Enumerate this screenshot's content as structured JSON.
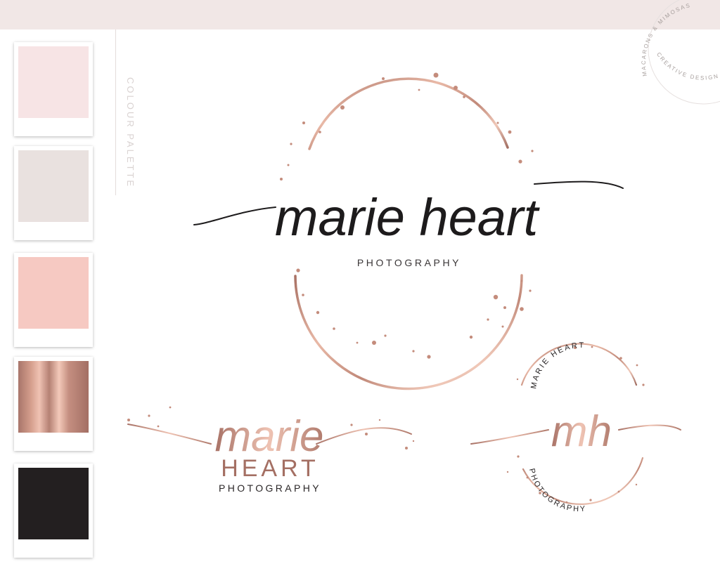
{
  "studio_badge": {
    "upper_text": "MACARONS & MIMOSAS",
    "lower_text": "CREATIVE DESIGN"
  },
  "palette": {
    "label": "COLOUR PALETTE",
    "swatches": [
      {
        "name": "blush",
        "color": "#f7e4e5"
      },
      {
        "name": "greige",
        "color": "#e9e1df"
      },
      {
        "name": "peach",
        "color": "#f6c9c2"
      },
      {
        "name": "rose-gold",
        "color": "#b98576"
      },
      {
        "name": "black",
        "color": "#231f20"
      }
    ]
  },
  "main_logo": {
    "script": "marie heart",
    "tagline": "PHOTOGRAPHY"
  },
  "secondary_logo": {
    "script": "marie",
    "name": "HEART",
    "tagline": "PHOTOGRAPHY"
  },
  "badge_logo": {
    "upper_arc": "MARIE HEART",
    "monogram": "mh",
    "lower_arc": "PHOTOGRAPHY"
  },
  "colors": {
    "rose_gold": "#c48c7c",
    "rose_gold_light": "#ecc3b3",
    "rose_gold_dark": "#9f6b5f",
    "ink": "#1d1b1c"
  }
}
